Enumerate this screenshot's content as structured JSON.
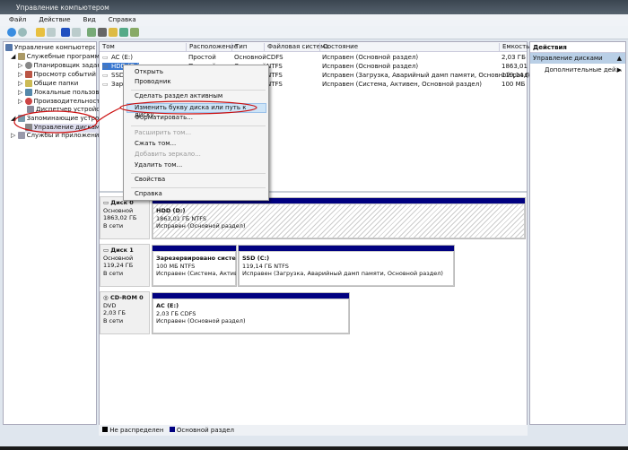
{
  "window": {
    "title": "Управление компьютером"
  },
  "menu": [
    "Файл",
    "Действие",
    "Вид",
    "Справка"
  ],
  "tree": [
    {
      "label": "Управление компьютером (л",
      "level": 0,
      "icon": "computer-icon"
    },
    {
      "label": "Служебные программы",
      "level": 1,
      "icon": "tools-icon"
    },
    {
      "label": "Планировщик заданий",
      "level": 2,
      "icon": "clock-icon"
    },
    {
      "label": "Просмотр событий",
      "level": 2,
      "icon": "event-viewer-icon"
    },
    {
      "label": "Общие папки",
      "level": 2,
      "icon": "shared-folder-icon"
    },
    {
      "label": "Локальные пользователи",
      "level": 2,
      "icon": "users-icon"
    },
    {
      "label": "Производительность",
      "level": 2,
      "icon": "performance-icon"
    },
    {
      "label": "Диспетчер устройств",
      "level": 2,
      "icon": "device-manager-icon"
    },
    {
      "label": "Запоминающие устройства",
      "level": 1,
      "icon": "storage-icon"
    },
    {
      "label": "Управление дисками",
      "level": 2,
      "icon": "disk-management-icon"
    },
    {
      "label": "Службы и приложения",
      "level": 1,
      "icon": "services-icon"
    }
  ],
  "table": {
    "headers": [
      "Том",
      "Расположение",
      "Тип",
      "Файловая система",
      "Состояние",
      "Емкость"
    ],
    "rows": [
      [
        "AC (E:)",
        "Простой",
        "Основной",
        "CDFS",
        "Исправен (Основной раздел)",
        "2,03 ГБ"
      ],
      [
        "HDD (D:)",
        "Простой",
        "Основной",
        "NTFS",
        "Исправен (Основной раздел)",
        "1863,01 ГБ"
      ],
      [
        "SSD (C:)",
        "Простой",
        "Основной",
        "NTFS",
        "Исправен (Загрузка, Аварийный дамп памяти, Основной раздел)",
        "119,14 ГБ"
      ],
      [
        "Зарезервировано системой",
        "Простой",
        "Основной",
        "NTFS",
        "Исправен (Система, Активен, Основной раздел)",
        "100 МБ"
      ]
    ]
  },
  "context_menu": [
    {
      "label": "Открыть"
    },
    {
      "label": "Проводник"
    },
    {
      "label": "Сделать раздел активным"
    },
    {
      "label": "Изменить букву диска или путь к диску...",
      "highlighted": true
    },
    {
      "label": "Форматировать..."
    },
    {
      "label": "Расширить том...",
      "disabled": true
    },
    {
      "label": "Сжать том..."
    },
    {
      "label": "Добавить зеркало...",
      "disabled": true
    },
    {
      "label": "Удалить том..."
    },
    {
      "label": "Свойства"
    },
    {
      "label": "Справка"
    }
  ],
  "disks": [
    {
      "name": "Диск 0",
      "type": "Основной",
      "size": "1863,02 ГБ",
      "status": "В сети",
      "partitions": [
        {
          "name": "HDD  (D:)",
          "size": "1863,01 ГБ NTFS",
          "state": "Исправен (Основной раздел)"
        }
      ]
    },
    {
      "name": "Диск 1",
      "type": "Основной",
      "size": "119,24 ГБ",
      "status": "В сети",
      "partitions": [
        {
          "name": "Зарезервировано системой",
          "size": "100 МБ NTFS",
          "state": "Исправен (Система, Активен,"
        },
        {
          "name": "SSD  (C:)",
          "size": "119,14 ГБ NTFS",
          "state": "Исправен (Загрузка, Аварийный дамп памяти, Основной раздел)"
        }
      ]
    },
    {
      "name": "CD-ROM 0",
      "type": "DVD",
      "size": "2,03 ГБ",
      "status": "В сети",
      "partitions": [
        {
          "name": "AC  (E:)",
          "size": "2,03 ГБ CDFS",
          "state": "Исправен (Основной раздел)"
        }
      ]
    }
  ],
  "actions": {
    "header": "Действия",
    "section": "Управление дисками",
    "more": "Дополнительные дей..."
  },
  "legend": [
    {
      "label": "Не распределен",
      "color": "#000000"
    },
    {
      "label": "Основной раздел",
      "color": "#000080"
    }
  ],
  "colors": {
    "primary_partition": "#000080",
    "annotation": "#cc1111",
    "highlight": "#cde4f7"
  }
}
